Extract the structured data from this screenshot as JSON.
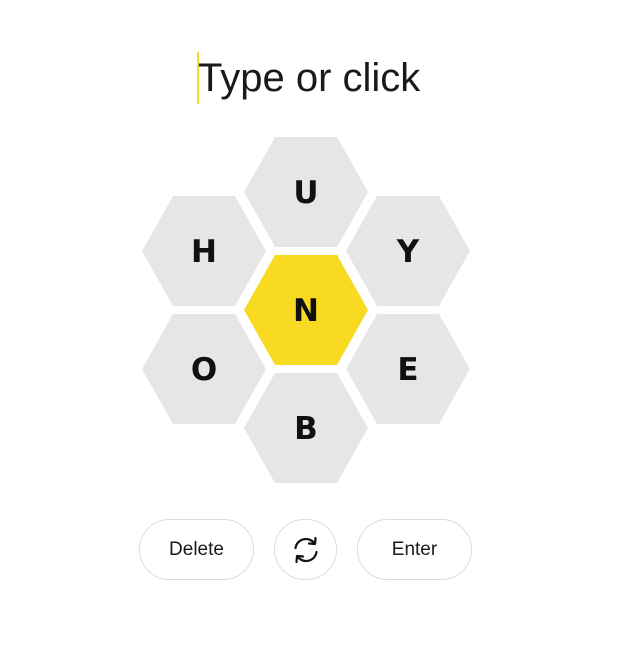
{
  "input": {
    "placeholder": "Type or click",
    "accent_color": "#f7da21"
  },
  "hive": {
    "center_letter": "N",
    "outer_letters": [
      "U",
      "Y",
      "E",
      "B",
      "O",
      "H"
    ],
    "center_color": "#f7da21",
    "outer_color": "#e6e6e6"
  },
  "controls": {
    "delete_label": "Delete",
    "shuffle_icon": "shuffle-icon",
    "enter_label": "Enter"
  }
}
